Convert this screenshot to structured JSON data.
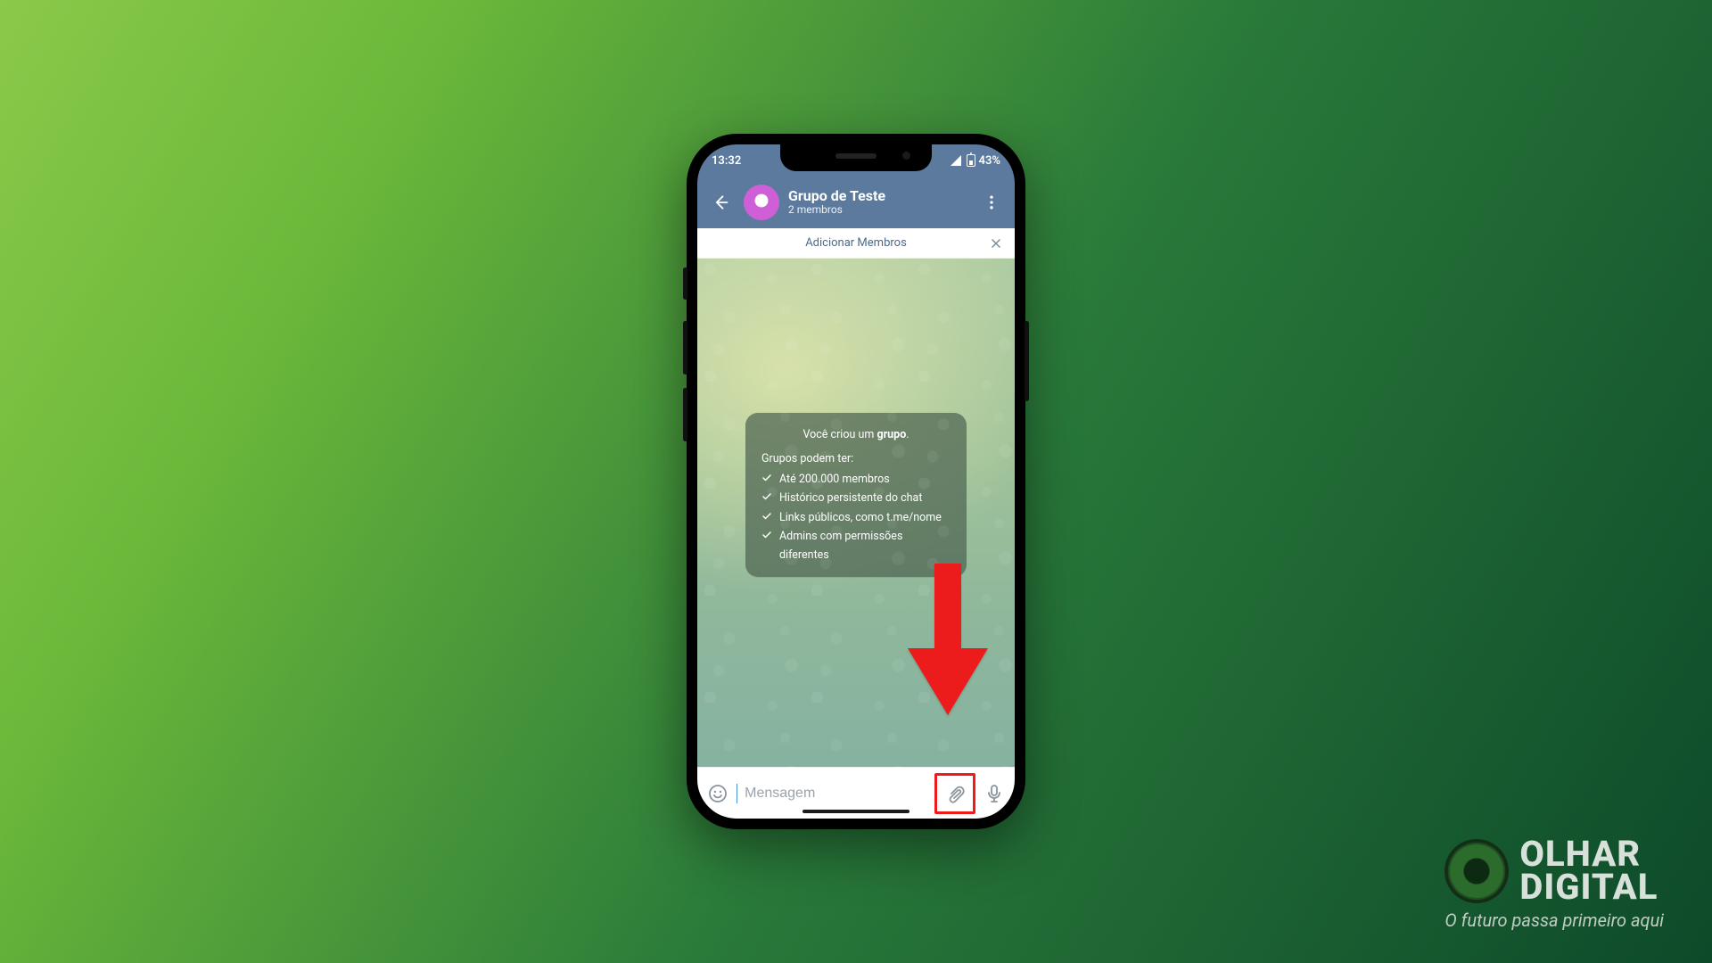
{
  "brand": {
    "line1": "OLHAR",
    "line2": "DIGITAL",
    "tagline": "O futuro passa primeiro aqui"
  },
  "statusbar": {
    "time": "13:32",
    "battery": "43%"
  },
  "header": {
    "title": "Grupo de Teste",
    "subtitle": "2 membros"
  },
  "add_members_bar": {
    "label": "Adicionar Membros"
  },
  "info_card": {
    "headline_prefix": "Você criou um ",
    "headline_bold": "grupo",
    "headline_suffix": ".",
    "subhead": "Grupos podem ter:",
    "items": [
      "Até 200.000 membros",
      "Histórico persistente do chat",
      "Links públicos, como t.me/nome",
      "Admins com permissões diferentes"
    ]
  },
  "input": {
    "placeholder": "Mensagem"
  },
  "annotation": {
    "arrow_color": "#ec1c1c",
    "highlight_color": "#ec1c1c"
  }
}
